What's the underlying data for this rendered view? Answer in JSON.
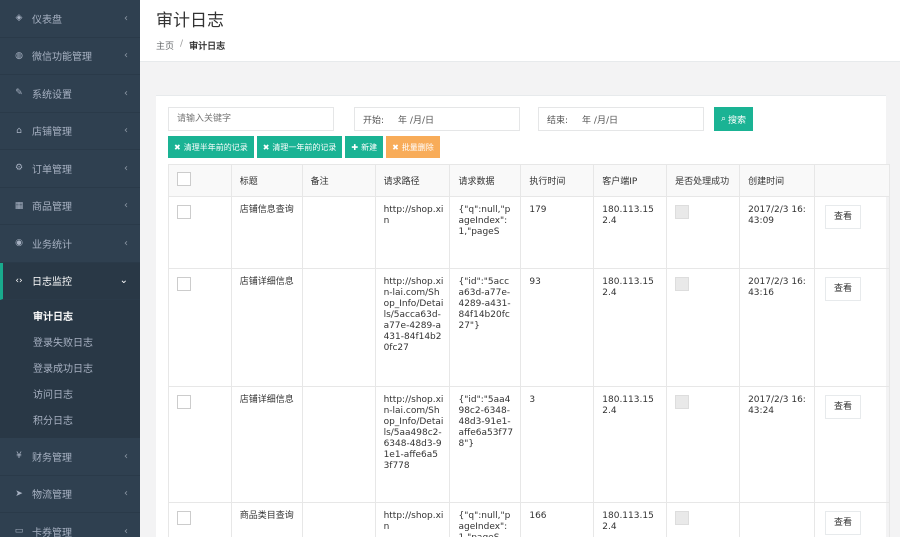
{
  "sidebar": {
    "items": [
      {
        "icon": "dashboard-icon",
        "glyph": "◈",
        "label": "仪表盘"
      },
      {
        "icon": "wechat-icon",
        "glyph": "◍",
        "label": "微信功能管理"
      },
      {
        "icon": "wrench-icon",
        "glyph": "✎",
        "label": "系统设置"
      },
      {
        "icon": "home-icon",
        "glyph": "⌂",
        "label": "店铺管理"
      },
      {
        "icon": "cogs-icon",
        "glyph": "⚙",
        "label": "订单管理"
      },
      {
        "icon": "cart-icon",
        "glyph": "▦",
        "label": "商品管理"
      },
      {
        "icon": "globe-icon",
        "glyph": "◉",
        "label": "业务统计"
      },
      {
        "icon": "code-icon",
        "glyph": "‹›",
        "label": "日志监控"
      }
    ],
    "submenu": [
      "审计日志",
      "登录失败日志",
      "登录成功日志",
      "访问日志",
      "积分日志"
    ],
    "items_after": [
      {
        "icon": "yen-icon",
        "glyph": "¥",
        "label": "财务管理"
      },
      {
        "icon": "send-icon",
        "glyph": "➤",
        "label": "物流管理"
      },
      {
        "icon": "card-icon",
        "glyph": "▭",
        "label": "卡券管理"
      }
    ]
  },
  "header": {
    "title": "审计日志",
    "breadcrumb_home": "主页",
    "breadcrumb_sep": "/",
    "breadcrumb_current": "审计日志"
  },
  "toolbar": {
    "search_placeholder": "请输入关键字",
    "start_label": "开始:",
    "start_value": "年 /月/日",
    "end_label": "结束:",
    "end_value": "年 /月/日",
    "search_label": "搜索"
  },
  "actions": {
    "clear_half_year": "清理半年前的记录",
    "clear_one_year": "清理一年前的记录",
    "new": "新建",
    "batch_delete": "批量删除"
  },
  "table": {
    "headers": [
      "标题",
      "备注",
      "请求路径",
      "请求数据",
      "执行时间",
      "客户端IP",
      "是否处理成功",
      "创建时间"
    ],
    "view_label": "查看",
    "rows": [
      {
        "title": "店铺信息查询",
        "remark": "",
        "path": "http://shop.xin",
        "data": "{\"q\":null,\"pageIndex\":1,\"pageS",
        "exec": "179",
        "ip": "180.113.152.4",
        "created": "2017/2/3 16:43:09"
      },
      {
        "title": "店铺详细信息",
        "remark": "",
        "path": "http://shop.xin-lai.com/Shop_Info/Details/5acca63d-a77e-4289-a431-84f14b20fc27",
        "data": "{\"id\":\"5acca63d-a77e-4289-a431-84f14b20fc27\"}",
        "exec": "93",
        "ip": "180.113.152.4",
        "created": "2017/2/3 16:43:16"
      },
      {
        "title": "店铺详细信息",
        "remark": "",
        "path": "http://shop.xin-lai.com/Shop_Info/Details/5aa498c2-6348-48d3-91e1-affe6a53f778",
        "data": "{\"id\":\"5aa498c2-6348-48d3-91e1-affe6a53f778\"}",
        "exec": "3",
        "ip": "180.113.152.4",
        "created": "2017/2/3 16:43:24"
      },
      {
        "title": "商品类目查询",
        "remark": "",
        "path": "http://shop.xin",
        "data": "{\"q\":null,\"pageIndex\":1,\"pageS",
        "exec": "166",
        "ip": "180.113.152.4",
        "created": ""
      }
    ]
  },
  "colors": {
    "sidebar_bg": "#2f4050",
    "accent": "#1ab394",
    "warning": "#f8ac59"
  }
}
